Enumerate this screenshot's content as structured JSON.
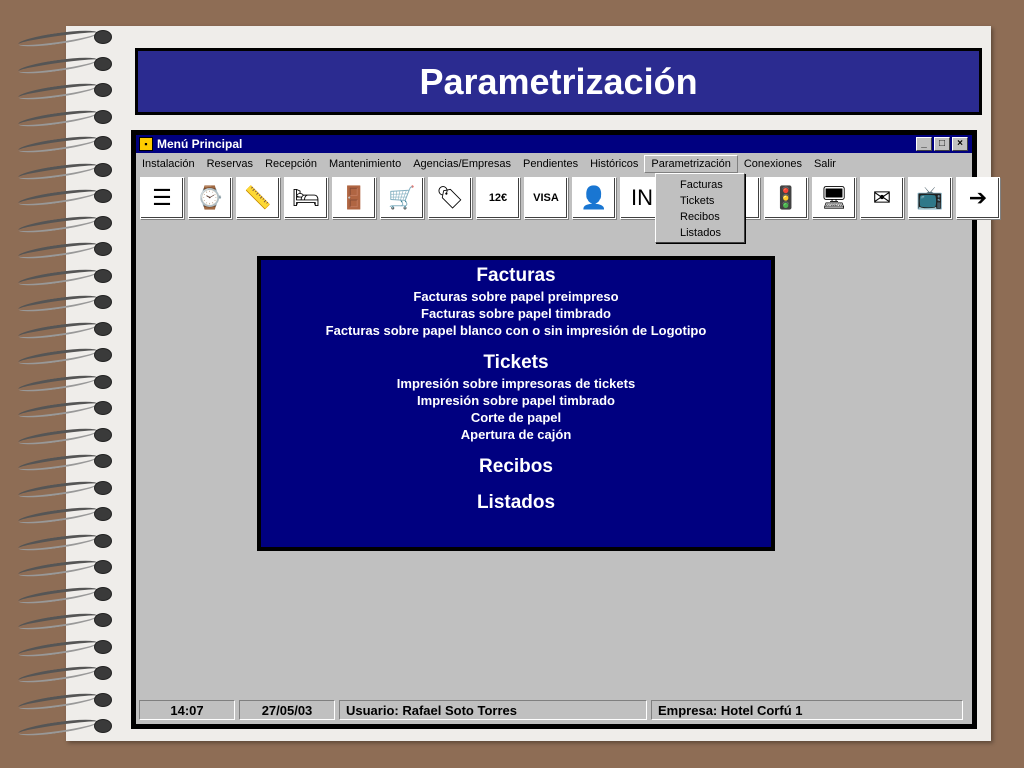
{
  "slide": {
    "title": "Parametrización"
  },
  "window": {
    "title": "Menú Principal",
    "controls": {
      "minimize": "_",
      "maximize": "□",
      "close": "×"
    }
  },
  "menubar": {
    "items": [
      {
        "label": "Instalación"
      },
      {
        "label": "Reservas"
      },
      {
        "label": "Recepción"
      },
      {
        "label": "Mantenimiento"
      },
      {
        "label": "Agencias/Empresas"
      },
      {
        "label": "Pendientes"
      },
      {
        "label": "Históricos"
      },
      {
        "label": "Parametrización"
      },
      {
        "label": "Conexiones"
      },
      {
        "label": "Salir"
      }
    ],
    "active_index": 7
  },
  "dropdown": {
    "items": [
      {
        "label": "Facturas"
      },
      {
        "label": "Tickets"
      },
      {
        "label": "Recibos"
      },
      {
        "label": "Listados"
      }
    ]
  },
  "toolbar": {
    "icons": [
      {
        "name": "list-icon",
        "glyph": "☰"
      },
      {
        "name": "clock-icon",
        "glyph": "⌚"
      },
      {
        "name": "ruler-icon",
        "glyph": "📏"
      },
      {
        "name": "bed-icon",
        "glyph": "🛏"
      },
      {
        "name": "door-icon",
        "glyph": "🚪"
      },
      {
        "name": "cart-icon",
        "glyph": "🛒"
      },
      {
        "name": "price-tag-plus-icon",
        "glyph": "🏷"
      },
      {
        "name": "price-tag-icon",
        "glyph": "12€"
      },
      {
        "name": "credit-card-icon",
        "glyph": "VISA"
      },
      {
        "name": "person-icon",
        "glyph": "👤"
      },
      {
        "name": "info-icon",
        "glyph": "IN"
      },
      {
        "name": "hidden-icon",
        "glyph": ""
      },
      {
        "name": "hidden-icon-2",
        "glyph": ""
      },
      {
        "name": "traffic-light-icon",
        "glyph": "🚦"
      },
      {
        "name": "computer-icon",
        "glyph": "🖥"
      },
      {
        "name": "envelope-icon",
        "glyph": "✉"
      },
      {
        "name": "tv-icon",
        "glyph": "📺"
      },
      {
        "name": "exit-icon",
        "glyph": "➔"
      }
    ]
  },
  "panel": {
    "facturas": {
      "heading": "Facturas",
      "lines": [
        "Facturas sobre papel preimpreso",
        "Facturas sobre papel timbrado",
        "Facturas sobre papel blanco con o sin impresión de Logotipo"
      ]
    },
    "tickets": {
      "heading": "Tickets",
      "lines": [
        "Impresión sobre impresoras de tickets",
        "Impresión sobre papel timbrado",
        "Corte de papel",
        "Apertura de cajón"
      ]
    },
    "recibos": {
      "heading": "Recibos"
    },
    "listados": {
      "heading": "Listados"
    }
  },
  "statusbar": {
    "time": "14:07",
    "date": "27/05/03",
    "user": "Usuario: Rafael Soto Torres",
    "company": "Empresa: Hotel Corfú 1"
  }
}
